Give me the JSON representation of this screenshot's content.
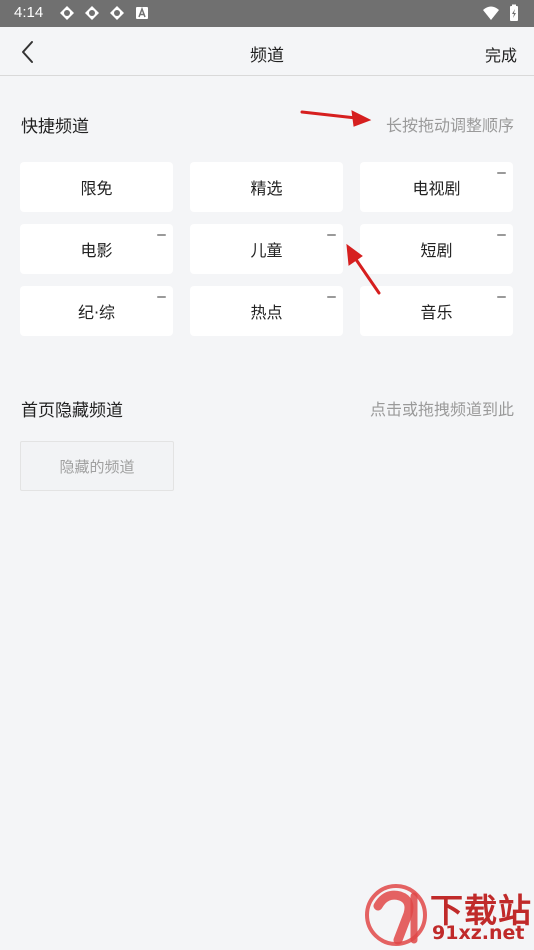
{
  "status_bar": {
    "time": "4:14"
  },
  "navbar": {
    "title": "频道",
    "done_label": "完成"
  },
  "quick_channels": {
    "title": "快捷频道",
    "hint": "长按拖动调整顺序",
    "items": [
      {
        "label": "限免",
        "removable": false
      },
      {
        "label": "精选",
        "removable": false
      },
      {
        "label": "电视剧",
        "removable": true
      },
      {
        "label": "电影",
        "removable": true
      },
      {
        "label": "儿童",
        "removable": true
      },
      {
        "label": "短剧",
        "removable": true
      },
      {
        "label": "纪·综",
        "removable": true
      },
      {
        "label": "热点",
        "removable": true
      },
      {
        "label": "音乐",
        "removable": true
      }
    ]
  },
  "hidden_channels": {
    "title": "首页隐藏频道",
    "hint": "点击或拖拽频道到此",
    "placeholder": "隐藏的频道"
  },
  "watermark": {
    "text_main": "下载站",
    "text_sub": "91xz.net"
  },
  "colors": {
    "accent_red": "#d61f1f",
    "background": "#f4f5f7"
  }
}
